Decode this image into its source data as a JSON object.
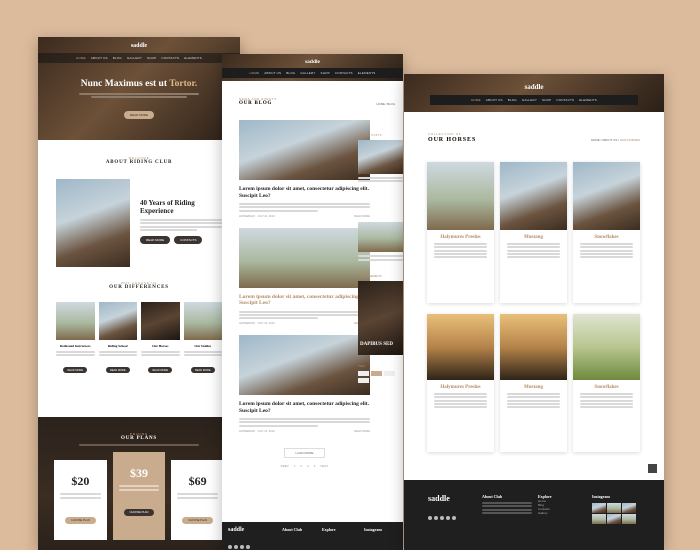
{
  "nav": {
    "items": [
      "HOME",
      "ABOUT US",
      "BLOG",
      "GALLERY",
      "SHOP",
      "CONTACTS",
      "ELEMENTS"
    ],
    "active": "HOME"
  },
  "brand": "saddle",
  "page1": {
    "hero_title_a": "Nunc Maximus est ut ",
    "hero_title_b": "Tortor.",
    "about_eyebrow": "WELCOME",
    "about_title": "ABOUT RIDING CLUB",
    "about_heading": "40 Years of Riding Experience",
    "btn_read_more": "READ MORE",
    "btn_contacts": "CONTACTS",
    "diff_eyebrow": "WHY CHOOSE US",
    "diff_title": "OUR DIFFERENCES",
    "differences": [
      {
        "title": "Dedicated Instructors",
        "btn": "READ MORE"
      },
      {
        "title": "Riding School",
        "btn": "READ MORE"
      },
      {
        "title": "Our Horses",
        "btn": "READ MORE"
      },
      {
        "title": "Our Stables",
        "btn": "READ MORE"
      }
    ],
    "plans_eyebrow": "PRICING",
    "plans_title": "OUR PLANS",
    "plans": [
      {
        "price": "$20",
        "btn": "CHOOSE PLAN"
      },
      {
        "price": "$39",
        "btn": "CHOOSE PLAN"
      },
      {
        "price": "$69",
        "btn": "CHOOSE PLAN"
      }
    ]
  },
  "page2": {
    "eyebrow": "NEWS AND EVENTS",
    "title": "OUR BLOG",
    "breadcrumb": "HOME / BLOG",
    "posts": [
      {
        "title": "Lorem ipsum dolor sit amet, consectetur adipiscing elit. Suscipit Leo?",
        "meta": "HORSEBACK  ·  JULY 24, 2019",
        "more": "READ MORE"
      },
      {
        "title": "Lorem ipsum dolor sit amet, consectetur adipiscing elit. Suscipit Leo?",
        "meta": "HORSEBACK  ·  JULY 24, 2019",
        "more": "READ MORE"
      },
      {
        "title": "Lorem ipsum dolor sit amet, consectetur adipiscing elit. Suscipit Leo?",
        "meta": "HORSEBACK  ·  JULY 24, 2019",
        "more": "READ MORE"
      }
    ],
    "sidebar_recent": "RECENT POSTS",
    "sidebar_adv": "ADVERTISEMENTS",
    "ad_text": "DAPIBUS SED",
    "sidebar_tags": "TAGS",
    "load_more": "LOAD MORE",
    "pagination": [
      "PREV",
      "1",
      "2",
      "3",
      "4",
      "NEXT"
    ],
    "footer": {
      "about": "About Club",
      "explore": "Explore",
      "instagram": "Instagram"
    }
  },
  "page3": {
    "eyebrow": "COLLECTION OF",
    "title": "OUR HORSES",
    "breadcrumb_a": "HOME / ABOUT US / ",
    "breadcrumb_b": "OUR HORSES",
    "horses": [
      {
        "name": "Halymures Preslus"
      },
      {
        "name": "Mustang"
      },
      {
        "name": "Snowflakes"
      },
      {
        "name": "Halymures Preslus"
      },
      {
        "name": "Mustang"
      },
      {
        "name": "Snowflakes"
      }
    ],
    "footer": {
      "about": "About Club",
      "explore": "Explore",
      "instagram": "Instagram",
      "explore_items": [
        "Home",
        "Blog",
        "Contacts",
        "Gallery"
      ]
    }
  },
  "colors": {
    "accent": "#b28c66",
    "dark": "#1f1f1f",
    "bg": "#dcbb9c"
  }
}
